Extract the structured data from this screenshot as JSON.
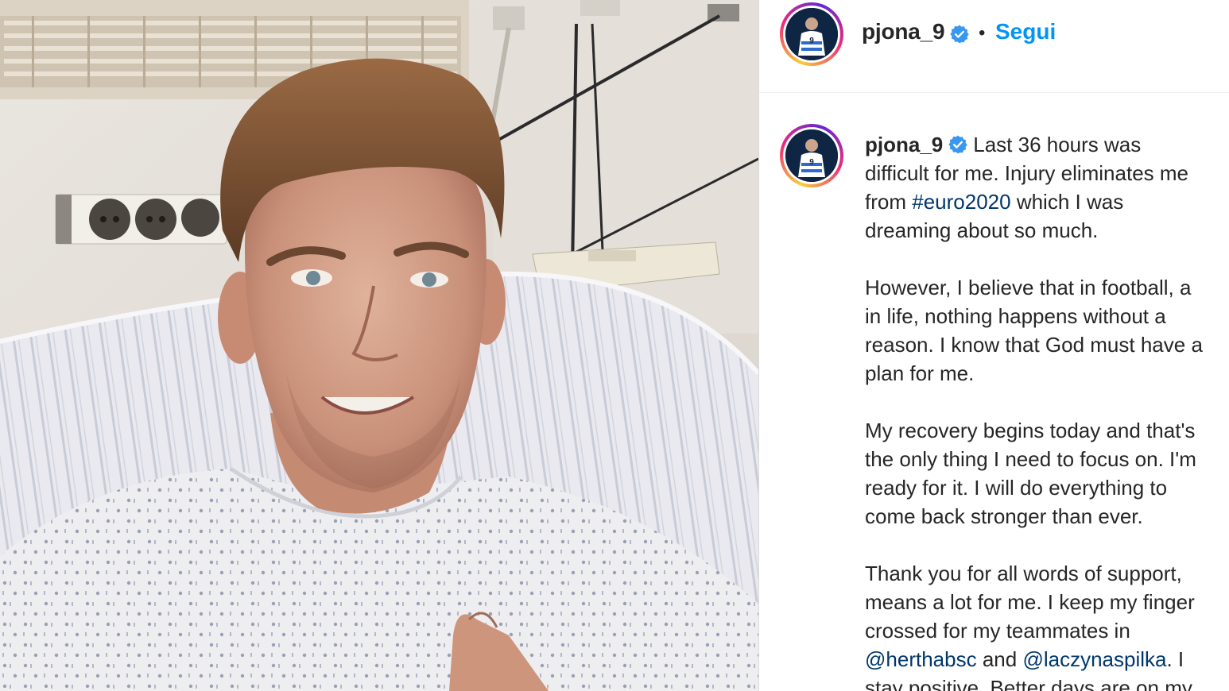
{
  "header": {
    "username": "pjona_9",
    "separator": "•",
    "follow_label": "Segui"
  },
  "caption": {
    "username": "pjona_9",
    "lines": [
      "Last 36 hours was",
      "difficult for me. Injury eliminates me",
      "which I was",
      "dreaming about so much.",
      "However, I believe that in football, a",
      "in life, nothing happens without a",
      "reason. I know that God must have a",
      "plan for me.",
      "My recovery begins today and that's",
      "the only thing I need to focus on. I'm",
      "ready for it. I will do everything to",
      "come back stronger than ever.",
      "Thank you for all words of support,",
      "means a lot for me. I keep my finger",
      "crossed for my teammates in",
      "and",
      ". I",
      "stay positive. Better days are on my"
    ],
    "from_word": "from",
    "hashtag": "#euro2020",
    "mention1": "@herthabsc",
    "mention2": "@laczynaspilka"
  },
  "icons": {
    "verified": "verified-badge-icon",
    "avatar": "profile-avatar"
  },
  "colors": {
    "link": "#0095f6",
    "hashtag": "#00376b",
    "text": "#262626",
    "verified": "#3897f0"
  }
}
